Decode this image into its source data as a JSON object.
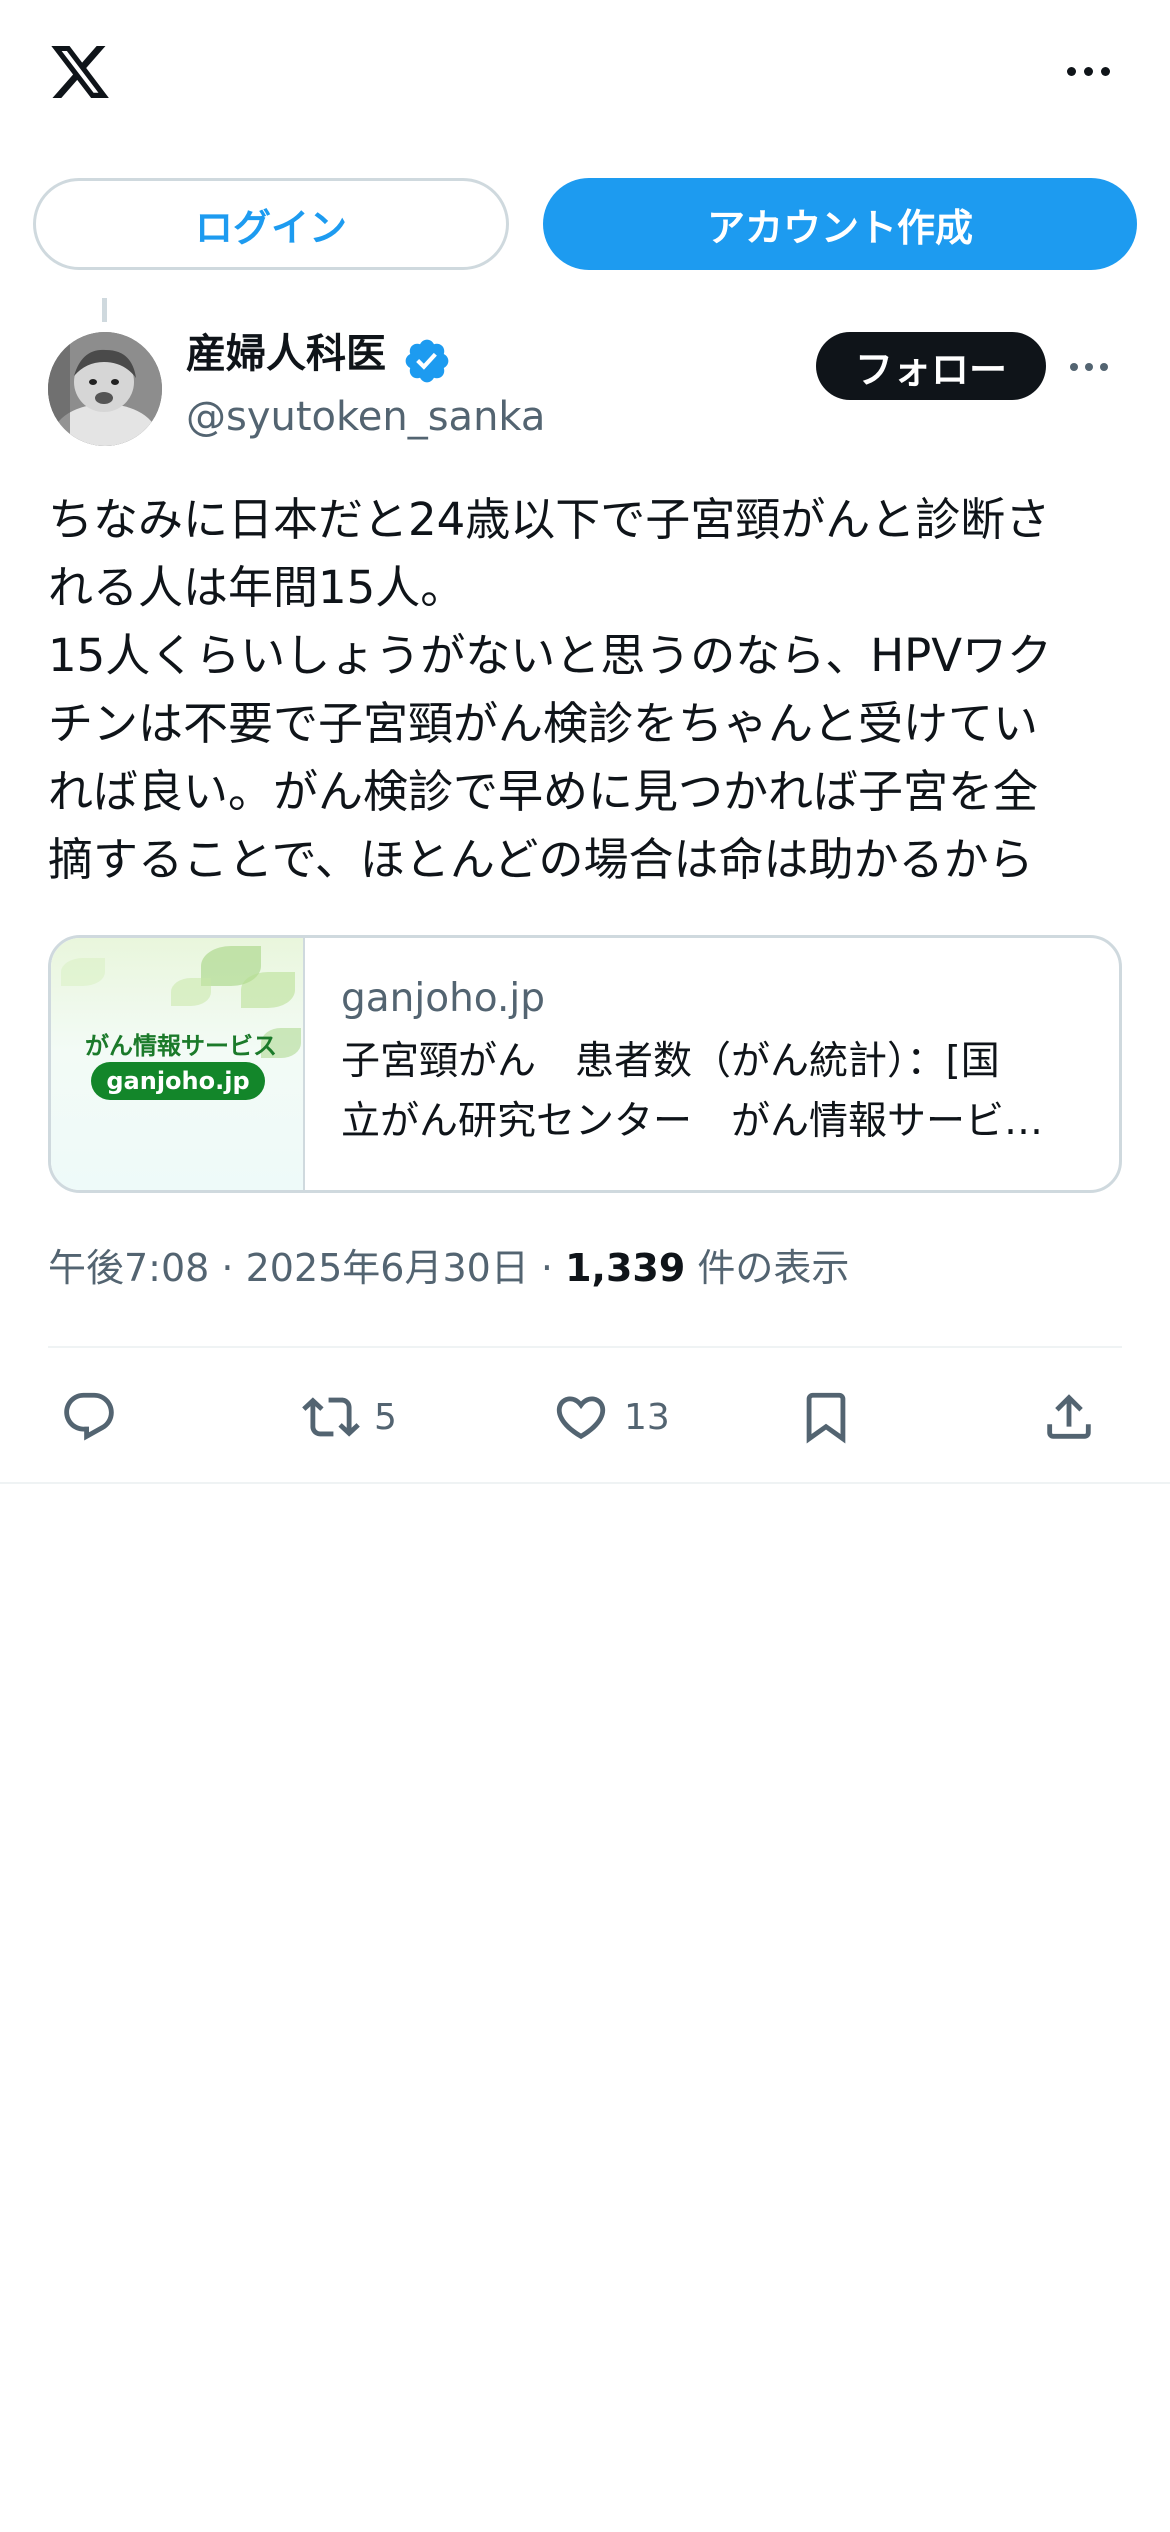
{
  "header": {
    "logo_icon": "x-logo-icon",
    "more_icon": "more-horizontal-icon"
  },
  "auth": {
    "login_label": "ログイン",
    "signup_label": "アカウント作成"
  },
  "author": {
    "display_name": "産婦人科医",
    "handle": "@syutoken_sanka",
    "verified": true,
    "follow_label": "フォロー"
  },
  "tweet": {
    "text": "ちなみに日本だと24歳以下で子宮頸がんと診断さ\nれる人は年間15人。\n15人くらいしょうがないと思うのなら、HPVワク\nチンは不要で子宮頸がん検診をちゃんと受けてい\nれば良い。がん検診で早めに見つかれば子宮を全\n摘することで、ほとんどの場合は命は助かるから"
  },
  "link_card": {
    "thumb_label": "がん情報サービス",
    "thumb_pill": "ganjoho.jp",
    "domain": "ganjoho.jp",
    "title": "子宮頸がん　患者数（がん統計）：[国\n立がん研究センター　がん情報サービ…"
  },
  "meta": {
    "time": "午後7:08",
    "sep1": " · ",
    "date": "2025年6月30日",
    "sep2": " · ",
    "views": "1,339",
    "views_label": " 件の表示"
  },
  "actions": {
    "reply_count": "",
    "retweet_count": "5",
    "like_count": "13"
  },
  "colors": {
    "accent": "#1d9bf0",
    "text": "#0f1419",
    "secondary": "#536471",
    "border": "#cfd9de"
  }
}
